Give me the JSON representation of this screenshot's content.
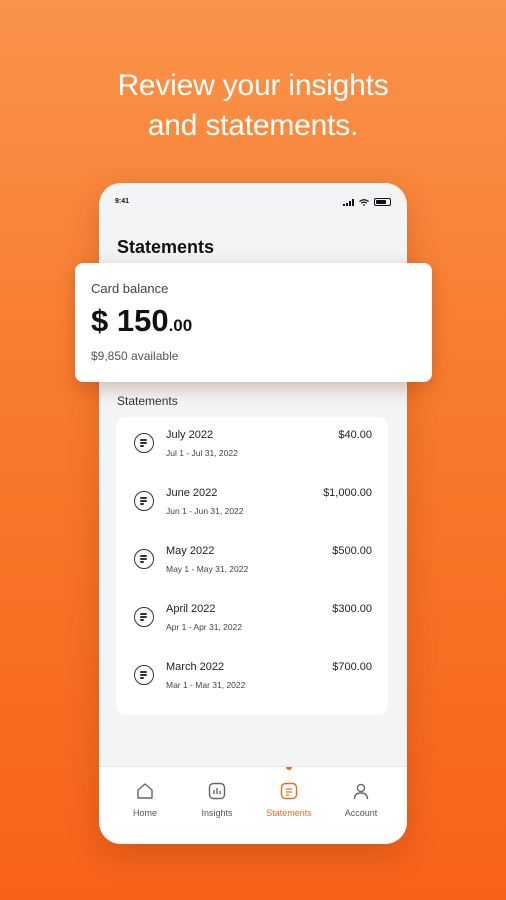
{
  "headline": {
    "line1": "Review your insights",
    "line2": "and statements."
  },
  "status_bar": {
    "time": "9:41"
  },
  "screen": {
    "title": "Statements",
    "balance_card": {
      "label": "Card balance",
      "amount_main": "$ 150",
      "amount_cents": ".00",
      "available": "$9,850 available"
    },
    "statements_label": "Statements",
    "statements": [
      {
        "month": "July 2022",
        "range": "Jul 1 - Jul 31, 2022",
        "amount": "$40.00"
      },
      {
        "month": "June 2022",
        "range": "Jun 1 - Jun 31, 2022",
        "amount": "$1,000.00"
      },
      {
        "month": "May 2022",
        "range": "May 1 - May 31, 2022",
        "amount": "$500.00"
      },
      {
        "month": "April 2022",
        "range": "Apr 1 - Apr 31, 2022",
        "amount": "$300.00"
      },
      {
        "month": "March 2022",
        "range": "Mar 1 - Mar 31, 2022",
        "amount": "$700.00"
      }
    ]
  },
  "tab_bar": {
    "tabs": [
      {
        "label": "Home",
        "icon": "home-icon"
      },
      {
        "label": "Insights",
        "icon": "insights-icon"
      },
      {
        "label": "Statements",
        "icon": "statements-icon",
        "active": true
      },
      {
        "label": "Account",
        "icon": "account-icon"
      }
    ]
  },
  "colors": {
    "accent": "#f06a1e",
    "background_top": "#f9934a",
    "background_bottom": "#f7621a"
  }
}
